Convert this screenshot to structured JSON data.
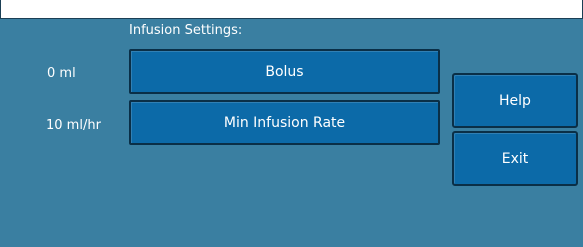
{
  "settings": {
    "title": "Infusion Settings:",
    "rows": [
      {
        "value": "0 ml",
        "button_label": "Bolus"
      },
      {
        "value": "10 ml/hr",
        "button_label": "Min Infusion Rate"
      }
    ]
  },
  "actions": {
    "help_label": "Help",
    "exit_label": "Exit"
  },
  "colors": {
    "background": "#3a7fa1",
    "button": "#0c6aa8",
    "button_border": "#0a2f47",
    "top_bar": "#ffffff"
  }
}
